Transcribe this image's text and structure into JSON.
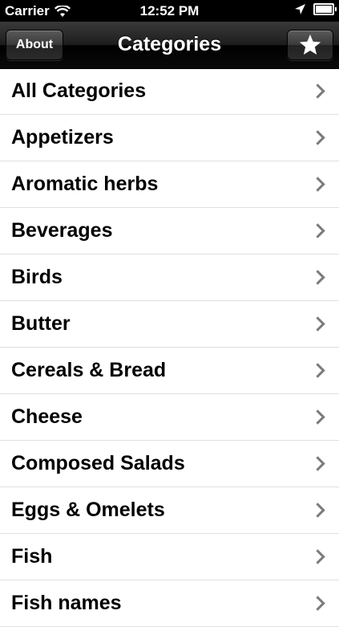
{
  "status_bar": {
    "carrier": "Carrier",
    "time": "12:52 PM",
    "wifi_icon": "wifi-icon",
    "location_icon": "location-arrow-icon",
    "battery_icon": "battery-full-icon"
  },
  "nav": {
    "title": "Categories",
    "about_label": "About",
    "favorites_icon": "star-icon"
  },
  "categories": [
    {
      "label": "All Categories"
    },
    {
      "label": "Appetizers"
    },
    {
      "label": "Aromatic herbs"
    },
    {
      "label": "Beverages"
    },
    {
      "label": "Birds"
    },
    {
      "label": "Butter"
    },
    {
      "label": "Cereals & Bread"
    },
    {
      "label": "Cheese"
    },
    {
      "label": "Composed Salads"
    },
    {
      "label": "Eggs & Omelets"
    },
    {
      "label": "Fish"
    },
    {
      "label": "Fish names"
    }
  ]
}
